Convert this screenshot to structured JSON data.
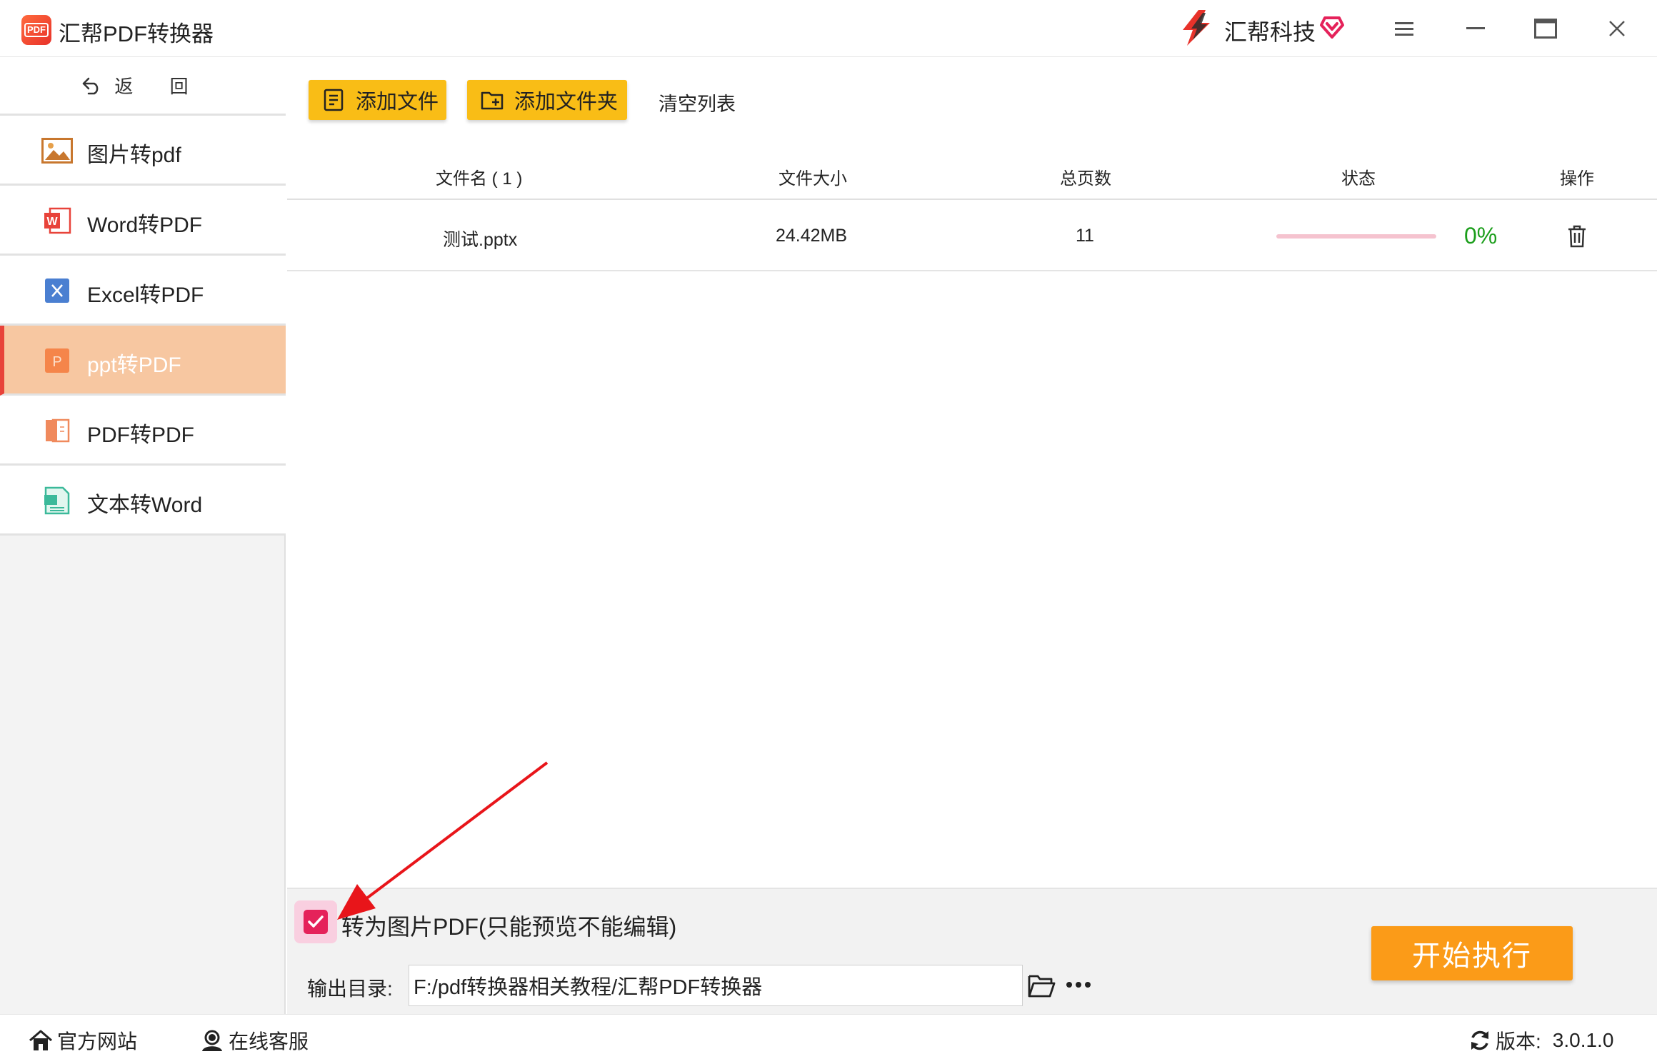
{
  "window": {
    "title": "汇帮PDF转换器",
    "brand": "汇帮科技",
    "colors": {
      "accent": "#f9bd16",
      "active_nav": "#f7c7a1",
      "start": "#fb9b18",
      "progress": "#1b9e1b",
      "check": "#e5225a"
    }
  },
  "sidebar": {
    "back_label": "返 回",
    "items": [
      {
        "label": "图片转pdf",
        "icon": "image-icon"
      },
      {
        "label": "Word转PDF",
        "icon": "word-icon"
      },
      {
        "label": "Excel转PDF",
        "icon": "excel-icon"
      },
      {
        "label": "ppt转PDF",
        "icon": "ppt-icon",
        "active": true
      },
      {
        "label": "PDF转PDF",
        "icon": "pdf-icon"
      },
      {
        "label": "文本转Word",
        "icon": "text-icon"
      }
    ]
  },
  "toolbar": {
    "add_file": "添加文件",
    "add_folder": "添加文件夹",
    "clear_list": "清空列表"
  },
  "table": {
    "headers": [
      "文件名 ( 1 )",
      "文件大小",
      "总页数",
      "状态",
      "操作"
    ],
    "rows": [
      {
        "name": "测试.pptx",
        "size": "24.42MB",
        "pages": "11",
        "progress": 0,
        "percent": "0%"
      }
    ]
  },
  "options": {
    "image_pdf_label": "转为图片PDF(只能预览不能编辑)",
    "image_pdf_checked": true,
    "output_label": "输出目录:",
    "output_path": "F:/pdf转换器相关教程/汇帮PDF转换器",
    "start_label": "开始执行"
  },
  "statusbar": {
    "website": "官方网站",
    "service": "在线客服",
    "version_label": "版本:",
    "version": "3.0.1.0"
  }
}
